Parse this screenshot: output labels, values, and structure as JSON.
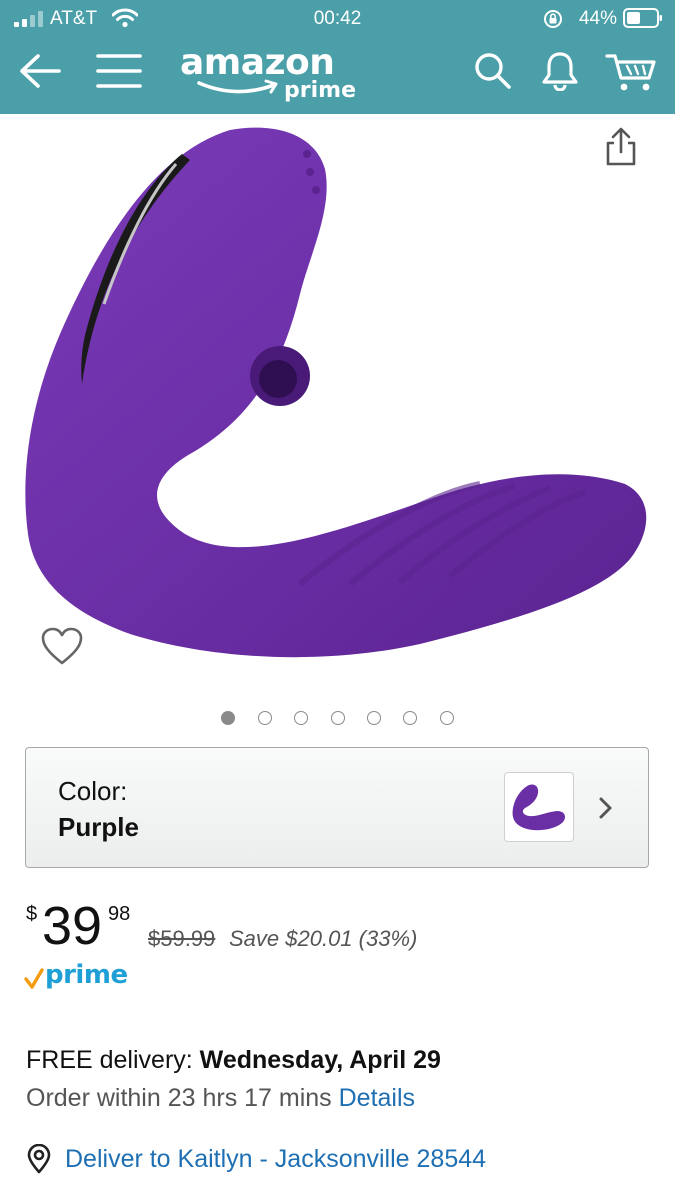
{
  "status_bar": {
    "carrier": "AT&T",
    "time": "00:42",
    "battery_percent": "44%"
  },
  "header": {
    "logo_text": "amazon",
    "logo_sub": "prime",
    "brand_color": "#4a9fa8"
  },
  "product": {
    "image_count": 7,
    "active_image_index": 0,
    "image_color": "#6a2ea5"
  },
  "color_selector": {
    "label": "Color:",
    "value": "Purple"
  },
  "price": {
    "symbol": "$",
    "whole": "39",
    "fraction": "98",
    "was": "$59.99",
    "savings": "Save $20.01 (33%)",
    "prime_label": "prime"
  },
  "delivery": {
    "prefix": "FREE delivery: ",
    "date": "Wednesday, April 29",
    "order_within": "Order within 23 hrs 17 mins ",
    "details_link": "Details",
    "deliver_to": "Deliver to Kaitlyn - Jacksonville 28544"
  },
  "icons": [
    "signal-icon",
    "wifi-icon",
    "orientation-lock-icon",
    "battery-icon",
    "back-arrow-icon",
    "menu-icon",
    "search-icon",
    "bell-icon",
    "cart-icon",
    "share-icon",
    "heart-icon",
    "chevron-right-icon",
    "location-pin-icon"
  ]
}
